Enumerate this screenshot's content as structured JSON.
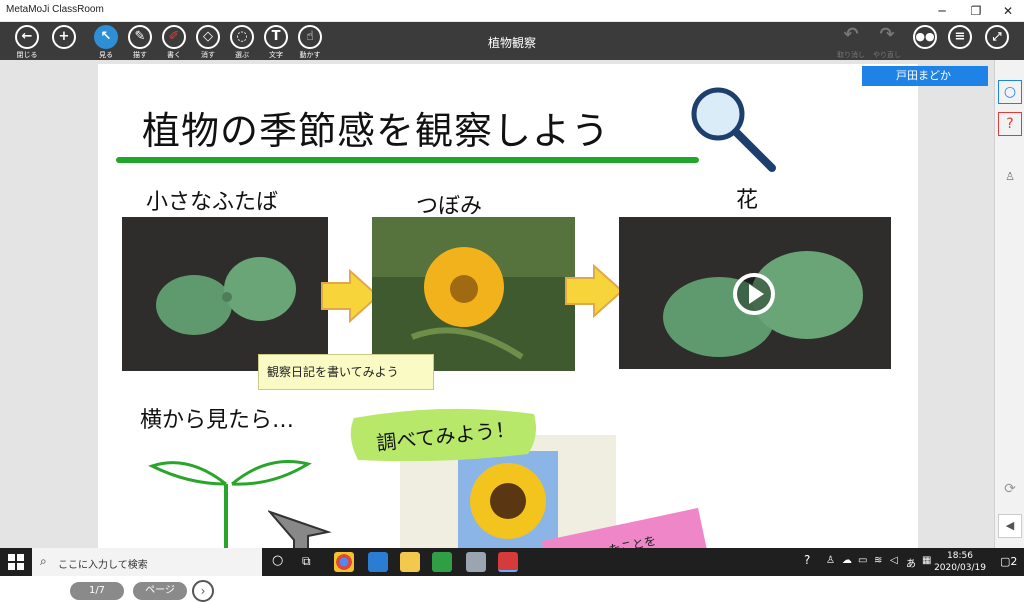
{
  "window": {
    "app_title": "MetaMoJi ClassRoom",
    "minimize": "─",
    "restore": "❐",
    "close": "✕"
  },
  "toolbar": {
    "document_title": "植物観察",
    "tools": [
      {
        "label": "閉じる",
        "glyph": "←"
      },
      {
        "label": "",
        "glyph": "+"
      },
      {
        "label": "見る",
        "glyph": "↖"
      },
      {
        "label": "描す",
        "glyph": "✎"
      },
      {
        "label": "書く",
        "glyph": "✐"
      },
      {
        "label": "消す",
        "glyph": "◇"
      },
      {
        "label": "選ぶ",
        "glyph": "◌"
      },
      {
        "label": "文字",
        "glyph": "T"
      },
      {
        "label": "動かす",
        "glyph": "☝"
      }
    ],
    "undo_label": "取り消し",
    "redo_label": "やり直し"
  },
  "user": {
    "name": "戸田まどか"
  },
  "canvas": {
    "title": "植物の季節感を観察しよう",
    "stage_labels": [
      "小さなふたば",
      "つぼみ",
      "花"
    ],
    "note_text": "観察日記を書いてみよう",
    "side_view_label": "横から見たら…",
    "bubble_text": "調べてみよう！",
    "pink_note_text": "わかったことを"
  },
  "pager": {
    "page": "1/7",
    "page_button": "ページ"
  },
  "taskbar": {
    "search_placeholder": "ここに入力して検索",
    "time": "18:56",
    "date": "2020/03/19",
    "notification_count": "2"
  },
  "colors": {
    "toolbar": "#3b3b3b",
    "accent": "#1e82e6",
    "underline": "#22a52c",
    "arrow": "#f6d43a"
  }
}
